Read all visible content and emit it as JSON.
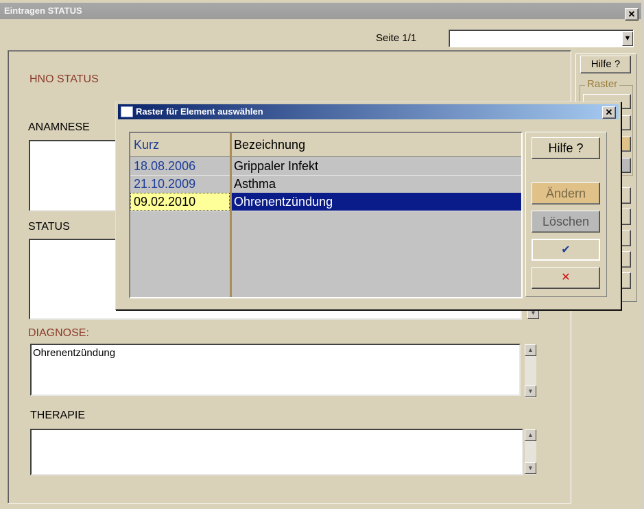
{
  "main_window": {
    "title": "Eintragen STATUS",
    "close_glyph": "✕",
    "page_label": "Seite 1/1",
    "page_combo_value": "",
    "dropdown_glyph": "▼"
  },
  "form": {
    "heading": "HNO  STATUS",
    "anamnese_label": "ANAMNESE",
    "anamnese_value": "",
    "status_label": "STATUS",
    "status_value": "",
    "diagnose_label": "DIAGNOSE:",
    "diagnose_value": "Ohrenentzündung",
    "therapie_label": "THERAPIE",
    "therapie_value": "",
    "scroll_up": "▲",
    "scroll_down": "▼"
  },
  "side_panel": {
    "hilfe_label": "Hilfe ?",
    "raster_label": "Raster"
  },
  "dialog": {
    "title": "Raster für Element auswählen",
    "close_glyph": "✕",
    "columns": [
      "Kurz",
      "Bezeichnung"
    ],
    "rows": [
      {
        "kurz": "18.08.2006",
        "bezeichnung": "Grippaler Infekt"
      },
      {
        "kurz": "21.10.2009",
        "bezeichnung": "Asthma"
      },
      {
        "kurz": "09.02.2010",
        "bezeichnung": "Ohrenentzündung"
      }
    ],
    "selected_row": 2,
    "buttons": {
      "hilfe": "Hilfe ?",
      "aendern": "Ändern",
      "loeschen": "Löschen",
      "ok": "✔",
      "cancel": "✕"
    }
  },
  "colors": {
    "accent_brown": "#8b3a2a",
    "selection_blue": "#0a1c8a",
    "date_blue": "#1e3d96",
    "active_cell_yellow": "#ffff99",
    "aendern_button": "#e0c188",
    "loeschen_button": "#b9b9b9",
    "cancel_red": "#d01010"
  }
}
